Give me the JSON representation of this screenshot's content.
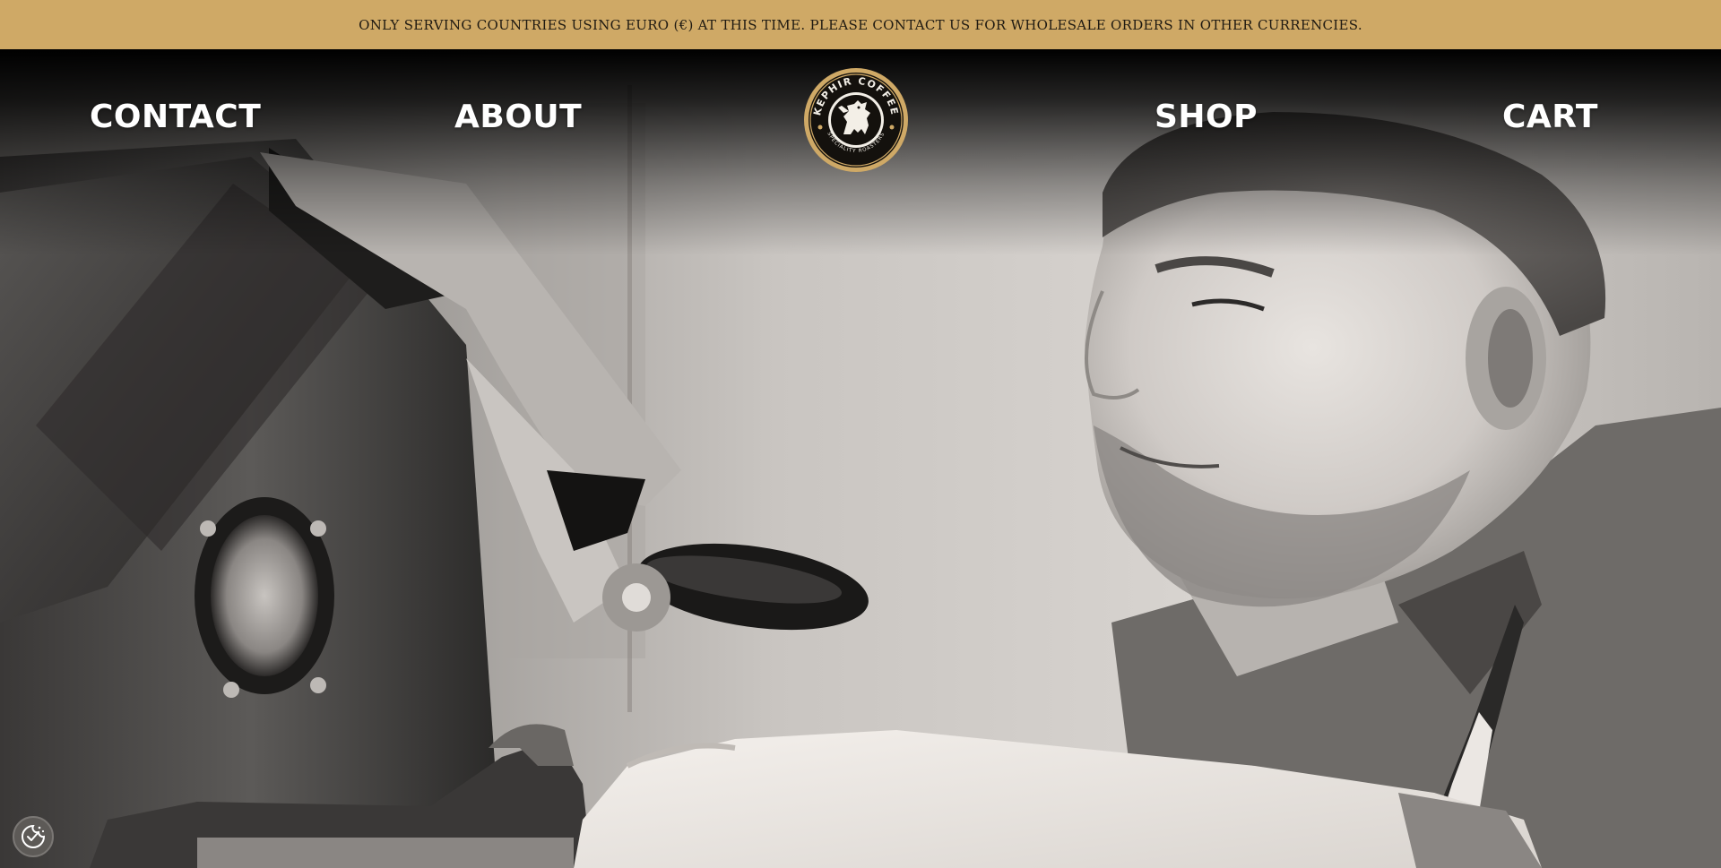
{
  "announcement": {
    "text": "ONLY SERVING COUNTRIES USING EURO (€) AT THIS TIME. PLEASE CONTACT US FOR WHOLESALE ORDERS IN OTHER CURRENCIES."
  },
  "nav": {
    "contact": "CONTACT",
    "about": "ABOUT",
    "shop": "SHOP",
    "cart": "CART"
  },
  "logo": {
    "top_text": "KEPHIR COFFEE",
    "bottom_text": "SPECIALITY ROASTERS",
    "icon": "griffin-emblem-icon"
  },
  "hero": {
    "image": "coffee-roaster-photo"
  },
  "cookie": {
    "icon": "cookie-consent-icon"
  },
  "colors": {
    "announcement_bg": "#cfa966",
    "logo_gold": "#cfa966",
    "logo_dark": "#14110d",
    "nav_text": "#ffffff"
  }
}
